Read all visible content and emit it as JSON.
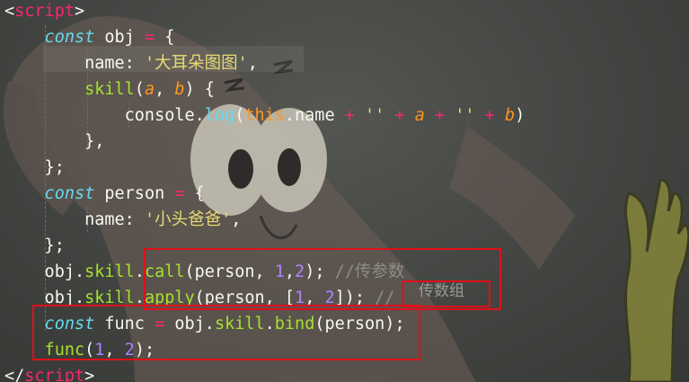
{
  "editor": {
    "lines": [
      [
        {
          "t": "<",
          "c": "#f8f8f2"
        },
        {
          "t": "script",
          "c": "#f92672"
        },
        {
          "t": ">",
          "c": "#f8f8f2"
        }
      ],
      [
        {
          "t": "    const ",
          "c": "#66d9ef",
          "i": 1
        },
        {
          "t": "obj ",
          "c": "#f8f8f2"
        },
        {
          "t": "=",
          "c": "#f92672"
        },
        {
          "t": " {",
          "c": "#f8f8f2"
        }
      ],
      [
        {
          "t": "        name",
          "c": "#f8f8f2"
        },
        {
          "t": ": ",
          "c": "#f8f8f2"
        },
        {
          "t": "'大耳朵图图'",
          "c": "#e6db74"
        },
        {
          "t": ",",
          "c": "#f8f8f2"
        }
      ],
      [
        {
          "t": "        skill",
          "c": "#a6e22e"
        },
        {
          "t": "(",
          "c": "#f8f8f2"
        },
        {
          "t": "a",
          "c": "#fd971f",
          "i": 1
        },
        {
          "t": ", ",
          "c": "#f8f8f2"
        },
        {
          "t": "b",
          "c": "#fd971f",
          "i": 1
        },
        {
          "t": ") {",
          "c": "#f8f8f2"
        }
      ],
      [
        {
          "t": "            console",
          "c": "#f8f8f2"
        },
        {
          "t": ".",
          "c": "#f8f8f2"
        },
        {
          "t": "log",
          "c": "#66d9ef"
        },
        {
          "t": "(",
          "c": "#f8f8f2"
        },
        {
          "t": "this",
          "c": "#fd971f"
        },
        {
          "t": ".name ",
          "c": "#f8f8f2"
        },
        {
          "t": "+",
          "c": "#f92672"
        },
        {
          "t": " ",
          "c": "#f8f8f2"
        },
        {
          "t": "''",
          "c": "#e6db74"
        },
        {
          "t": " ",
          "c": "#f8f8f2"
        },
        {
          "t": "+",
          "c": "#f92672"
        },
        {
          "t": " ",
          "c": "#f8f8f2"
        },
        {
          "t": "a",
          "c": "#fd971f",
          "i": 1
        },
        {
          "t": " ",
          "c": "#f8f8f2"
        },
        {
          "t": "+",
          "c": "#f92672"
        },
        {
          "t": " ",
          "c": "#f8f8f2"
        },
        {
          "t": "''",
          "c": "#e6db74"
        },
        {
          "t": " ",
          "c": "#f8f8f2"
        },
        {
          "t": "+",
          "c": "#f92672"
        },
        {
          "t": " ",
          "c": "#f8f8f2"
        },
        {
          "t": "b",
          "c": "#fd971f",
          "i": 1
        },
        {
          "t": ")",
          "c": "#f8f8f2"
        }
      ],
      [
        {
          "t": "        },",
          "c": "#f8f8f2"
        }
      ],
      [
        {
          "t": "    };",
          "c": "#f8f8f2"
        }
      ],
      [
        {
          "t": "    const ",
          "c": "#66d9ef",
          "i": 1
        },
        {
          "t": "person ",
          "c": "#f8f8f2"
        },
        {
          "t": "=",
          "c": "#f92672"
        },
        {
          "t": " {",
          "c": "#f8f8f2"
        }
      ],
      [
        {
          "t": "        name",
          "c": "#f8f8f2"
        },
        {
          "t": ": ",
          "c": "#f8f8f2"
        },
        {
          "t": "'小头爸爸'",
          "c": "#e6db74"
        },
        {
          "t": ",",
          "c": "#f8f8f2"
        }
      ],
      [
        {
          "t": "    };",
          "c": "#f8f8f2"
        }
      ],
      [
        {
          "t": "    obj",
          "c": "#f8f8f2"
        },
        {
          "t": ".",
          "c": "#f8f8f2"
        },
        {
          "t": "skill",
          "c": "#a6e22e"
        },
        {
          "t": ".",
          "c": "#f8f8f2"
        },
        {
          "t": "call",
          "c": "#a6e22e"
        },
        {
          "t": "(person, ",
          "c": "#f8f8f2"
        },
        {
          "t": "1",
          "c": "#ae81ff"
        },
        {
          "t": ",",
          "c": "#f8f8f2"
        },
        {
          "t": "2",
          "c": "#ae81ff"
        },
        {
          "t": "); ",
          "c": "#f8f8f2"
        },
        {
          "t": "//传参数",
          "c": "#8c8d88"
        }
      ],
      [
        {
          "t": "    obj",
          "c": "#f8f8f2"
        },
        {
          "t": ".",
          "c": "#f8f8f2"
        },
        {
          "t": "skill",
          "c": "#a6e22e"
        },
        {
          "t": ".",
          "c": "#f8f8f2"
        },
        {
          "t": "apply",
          "c": "#a6e22e"
        },
        {
          "t": "(person, [",
          "c": "#f8f8f2"
        },
        {
          "t": "1",
          "c": "#ae81ff"
        },
        {
          "t": ", ",
          "c": "#f8f8f2"
        },
        {
          "t": "2",
          "c": "#ae81ff"
        },
        {
          "t": "]); ",
          "c": "#f8f8f2"
        },
        {
          "t": "//",
          "c": "#8c8d88"
        }
      ],
      [
        {
          "t": "    const ",
          "c": "#66d9ef",
          "i": 1
        },
        {
          "t": "func ",
          "c": "#f8f8f2"
        },
        {
          "t": "=",
          "c": "#f92672"
        },
        {
          "t": " obj",
          "c": "#f8f8f2"
        },
        {
          "t": ".",
          "c": "#f8f8f2"
        },
        {
          "t": "skill",
          "c": "#a6e22e"
        },
        {
          "t": ".",
          "c": "#f8f8f2"
        },
        {
          "t": "bind",
          "c": "#a6e22e"
        },
        {
          "t": "(person);",
          "c": "#f8f8f2"
        }
      ],
      [
        {
          "t": "    func",
          "c": "#a6e22e"
        },
        {
          "t": "(",
          "c": "#f8f8f2"
        },
        {
          "t": "1",
          "c": "#ae81ff"
        },
        {
          "t": ", ",
          "c": "#f8f8f2"
        },
        {
          "t": "2",
          "c": "#ae81ff"
        },
        {
          "t": ");",
          "c": "#f8f8f2"
        }
      ],
      [
        {
          "t": "</",
          "c": "#f8f8f2"
        },
        {
          "t": "script",
          "c": "#f92672"
        },
        {
          "t": ">",
          "c": "#f8f8f2"
        }
      ]
    ],
    "annotation_note": "传数组"
  },
  "colors": {
    "background": "#434542",
    "highlight_box": "#e0101a"
  }
}
